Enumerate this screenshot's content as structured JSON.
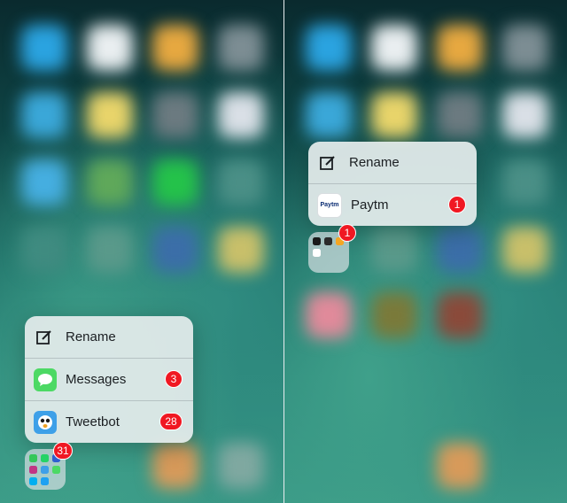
{
  "left_menu": {
    "items": [
      {
        "label": "Rename",
        "icon": "rename-icon"
      },
      {
        "label": "Messages",
        "icon": "messages-app-icon",
        "badge": "3"
      },
      {
        "label": "Tweetbot",
        "icon": "tweetbot-app-icon",
        "badge": "28"
      }
    ],
    "folder_badge": "31"
  },
  "right_menu": {
    "items": [
      {
        "label": "Rename",
        "icon": "rename-icon"
      },
      {
        "label": "Paytm",
        "icon": "paytm-app-icon",
        "badge": "1",
        "icon_text": "Paytm"
      }
    ],
    "folder_badge": "1"
  },
  "colors": {
    "badge": "#f01822",
    "messages_green": "#4cd964",
    "tweetbot_blue": "#3ea0e8",
    "paytm_blue": "#0b2d73"
  }
}
